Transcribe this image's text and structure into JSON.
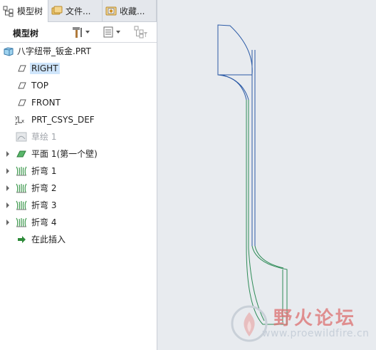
{
  "tabs": [
    {
      "label": "模型树",
      "icon": "model-tree-icon",
      "active": true
    },
    {
      "label": "文件...",
      "icon": "folder-browser-icon",
      "active": false
    },
    {
      "label": "收藏...",
      "icon": "favorites-icon",
      "active": false
    }
  ],
  "toolbar": {
    "title": "模型树",
    "settings_icon": "hammer-settings-icon",
    "show_icon": "show-list-icon",
    "filter_icon": "tree-filter-icon"
  },
  "tree": {
    "root": {
      "label": "八字纽带_钣金.PRT",
      "icon": "part-icon"
    },
    "items": [
      {
        "label": "RIGHT",
        "icon": "datum-plane-icon",
        "selected": true
      },
      {
        "label": "TOP",
        "icon": "datum-plane-icon"
      },
      {
        "label": "FRONT",
        "icon": "datum-plane-icon"
      },
      {
        "label": "PRT_CSYS_DEF",
        "icon": "csys-icon"
      },
      {
        "label": "草绘 1",
        "icon": "sketch-icon",
        "disabled": true
      },
      {
        "label": "平面 1(第一个壁)",
        "icon": "flat-wall-icon",
        "expandable": true
      },
      {
        "label": "折弯 1",
        "icon": "bend-icon",
        "expandable": true
      },
      {
        "label": "折弯 2",
        "icon": "bend-icon",
        "expandable": true
      },
      {
        "label": "折弯 3",
        "icon": "bend-icon",
        "expandable": true
      },
      {
        "label": "折弯 4",
        "icon": "bend-icon",
        "expandable": true
      },
      {
        "label": "在此插入",
        "icon": "insert-here-arrow-icon"
      }
    ]
  },
  "colors": {
    "model_edge_blue": "#2b5aa6",
    "model_edge_green": "#2e8b57",
    "selection": "#cfe5fb",
    "viewport_bg": "#e8ebef"
  },
  "watermark": {
    "title": "野火论坛",
    "url": "www.proewildfire.cn"
  }
}
